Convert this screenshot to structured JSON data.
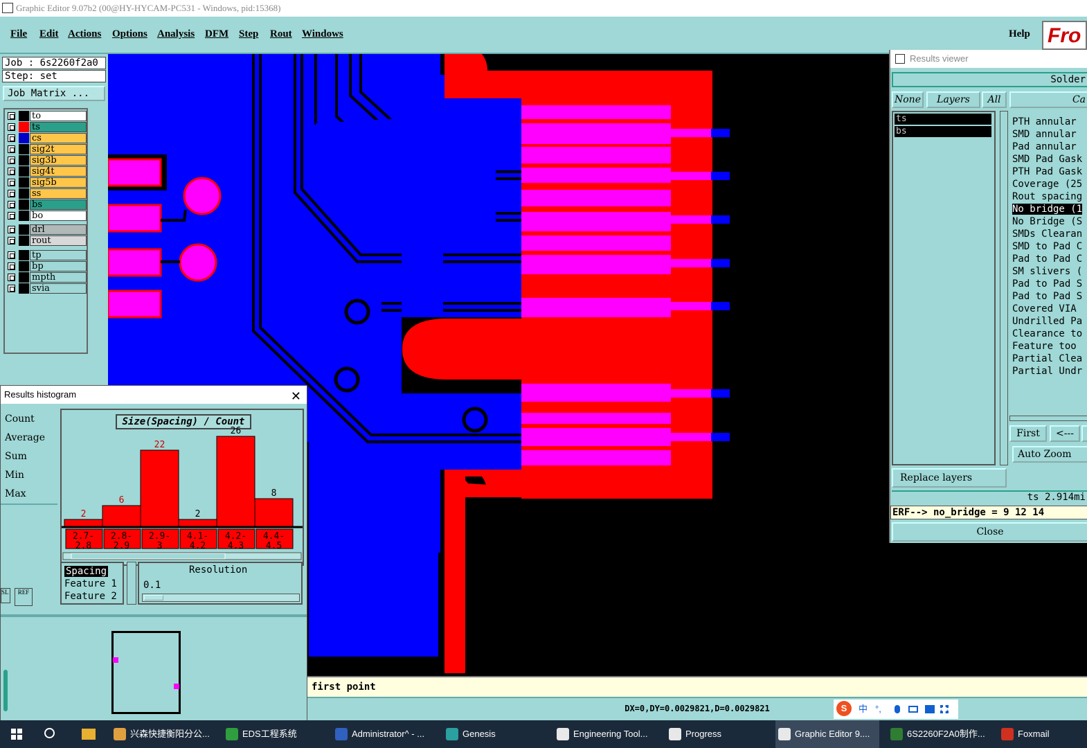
{
  "window": {
    "title": "Graphic Editor 9.07b2 (00@HY-HYCAM-PC531 - Windows, pid:15368)"
  },
  "menu": {
    "items": [
      "File",
      "Edit",
      "Actions",
      "Options",
      "Analysis",
      "DFM",
      "Step",
      "Rout",
      "Windows"
    ],
    "help": "Help",
    "brand": "Fro"
  },
  "left": {
    "job": "Job : 6s2260f2a0",
    "step": "Step: set",
    "job_matrix": "Job Matrix ...",
    "layers": [
      {
        "name": "to",
        "swatch": "#000000",
        "bg": "#ffffff"
      },
      {
        "name": "ts",
        "swatch": "#ff0000",
        "bg": "#2aa08a"
      },
      {
        "name": "cs",
        "swatch": "#0000c8",
        "bg": "#ffc64a"
      },
      {
        "name": "sig2t",
        "swatch": "#000000",
        "bg": "#ffc64a"
      },
      {
        "name": "sig3b",
        "swatch": "#000000",
        "bg": "#ffc64a"
      },
      {
        "name": "sig4t",
        "swatch": "#000000",
        "bg": "#ffc64a"
      },
      {
        "name": "sig5b",
        "swatch": "#000000",
        "bg": "#ffc64a"
      },
      {
        "name": "ss",
        "swatch": "#000000",
        "bg": "#ffc64a"
      },
      {
        "name": "bs",
        "swatch": "#000000",
        "bg": "#2aa08a"
      },
      {
        "name": "bo",
        "swatch": "#000000",
        "bg": "#ffffff"
      },
      {
        "name": "drl",
        "swatch": "#000000",
        "bg": "#b0b8b8"
      },
      {
        "name": "rout",
        "swatch": "#000000",
        "bg": "#d8d8d8"
      },
      {
        "name": "tp",
        "swatch": "#000000",
        "bg": "#9fd8d6"
      },
      {
        "name": "bp",
        "swatch": "#000000",
        "bg": "#9fd8d6"
      },
      {
        "name": "mpth",
        "swatch": "#000000",
        "bg": "#9fd8d6"
      },
      {
        "name": "svia",
        "swatch": "#000000",
        "bg": "#9fd8d6"
      }
    ]
  },
  "histogram": {
    "title": "Results histogram",
    "close": "X",
    "stats": [
      "Count",
      "Average",
      "Sum",
      "Min",
      "Max"
    ],
    "chart_title": "Size(Spacing) / Count",
    "chart_data": {
      "type": "bar",
      "title": "Size(Spacing) / Count",
      "categories": [
        "2.7-2.8",
        "2.8-2.9",
        "2.9-3",
        "4.1-4.2",
        "4.2-4.3",
        "4.4-4.5"
      ],
      "values": [
        2,
        6,
        22,
        2,
        26,
        8
      ],
      "bar_color": "#ff0000",
      "label_colors": [
        "#cc0000",
        "#cc0000",
        "#cc0000",
        "#000000",
        "#000000",
        "#000000"
      ],
      "ylim": [
        0,
        28
      ]
    },
    "bins": [
      {
        "top": "2.7-",
        "bottom": "2.8"
      },
      {
        "top": "2.8-",
        "bottom": "2.9"
      },
      {
        "top": "2.9-",
        "bottom": "3"
      },
      {
        "top": "4.1-",
        "bottom": "4.2"
      },
      {
        "top": "4.2-",
        "bottom": "4.3"
      },
      {
        "top": "4.4-",
        "bottom": "4.5"
      }
    ],
    "features": [
      "Spacing",
      "Feature 1",
      "Feature 2"
    ],
    "resolution_label": "Resolution",
    "resolution_value": "0.1",
    "side_buttons": [
      "SL",
      "REF"
    ]
  },
  "command_line": "first point",
  "status_line": "DX=0,DY=0.0029821,D=0.0029821",
  "viewer": {
    "title": "Results viewer",
    "header": "Solder",
    "buttons": {
      "none": "None",
      "layers": "Layers",
      "all": "All"
    },
    "cat_header": "Ca",
    "layer_list": [
      "ts",
      "bs"
    ],
    "checks": [
      "PTH annular",
      "SMD annular",
      "Pad annular",
      "SMD Pad Gask",
      "PTH Pad Gask",
      "Coverage (25",
      "Rout spacing",
      "No bridge (1",
      "No Bridge (S",
      "SMDs Clearan",
      "SMD to Pad C",
      "Pad to Pad C",
      "SM slivers (",
      "Pad to Pad S",
      "Pad to Pad S",
      "Covered VIA",
      "Undrilled Pa",
      "Clearance to",
      "Feature too",
      "Partial Clea",
      "Partial Undr"
    ],
    "selected_check": 7,
    "first": "First",
    "back": "<---",
    "auto_zoom": "Auto Zoom",
    "replace_layers": "Replace layers",
    "ts_info": "ts 2.914mi",
    "erf": "ERF--> no_bridge = 9 12 14",
    "close": "Close"
  },
  "taskbar": {
    "items": [
      {
        "label": "兴森快捷衡阳分公...",
        "color": "#e0a040"
      },
      {
        "label": "EDS工程系统",
        "color": "#2e9e3e"
      },
      {
        "label": "Administrator^ - ...",
        "color": "#3060c0"
      },
      {
        "label": "Genesis",
        "color": "#2aa0a0"
      },
      {
        "label": "Engineering Tool...",
        "color": "#e8e8e8"
      },
      {
        "label": "Progress",
        "color": "#e8e8e8"
      },
      {
        "label": "Graphic Editor 9....",
        "color": "#e8e8e8"
      },
      {
        "label": "6S2260F2A0制作...",
        "color": "#2e7d32"
      },
      {
        "label": "Foxmail",
        "color": "#d03020"
      }
    ],
    "tray": [
      "S",
      "中",
      "°,",
      "mic",
      "kbd",
      "shirt",
      "grid"
    ]
  }
}
